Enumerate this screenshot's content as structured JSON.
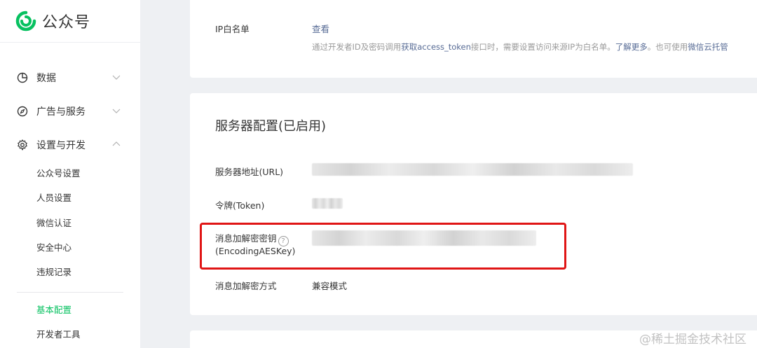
{
  "app": {
    "title": "公众号"
  },
  "sidebar": {
    "groups": [
      {
        "label": "数据",
        "icon": "pie-chart-icon",
        "expanded": false
      },
      {
        "label": "广告与服务",
        "icon": "compass-icon",
        "expanded": false
      },
      {
        "label": "设置与开发",
        "icon": "gear-icon",
        "expanded": true
      }
    ],
    "sub_items": [
      {
        "label": "公众号设置"
      },
      {
        "label": "人员设置"
      },
      {
        "label": "微信认证"
      },
      {
        "label": "安全中心"
      },
      {
        "label": "违规记录"
      },
      {
        "label": "基本配置",
        "active": true
      },
      {
        "label": "开发者工具"
      }
    ]
  },
  "ip_whitelist": {
    "label": "IP白名单",
    "link": "查看",
    "desc_pre": "通过开发者ID及密码调用",
    "desc_link1": "获取access_token",
    "desc_mid": "接口时，需要设置访问来源IP为白名单。",
    "desc_link2": "了解更多",
    "desc_post": "。也可使用",
    "desc_link3": "微信云托管"
  },
  "server_config": {
    "title": "服务器配置(已启用)",
    "url_label": "服务器地址(URL)",
    "token_label": "令牌(Token)",
    "aes_label_line1": "消息加解密密钥",
    "aes_label_line2": "(EncodingAESKey)",
    "mode_label": "消息加解密方式",
    "mode_value": "兼容模式",
    "help_glyph": "?"
  },
  "watermark": "@稀土掘金技术社区",
  "colors": {
    "accent": "#07c160",
    "link": "#576b95",
    "highlight": "#e01515"
  }
}
